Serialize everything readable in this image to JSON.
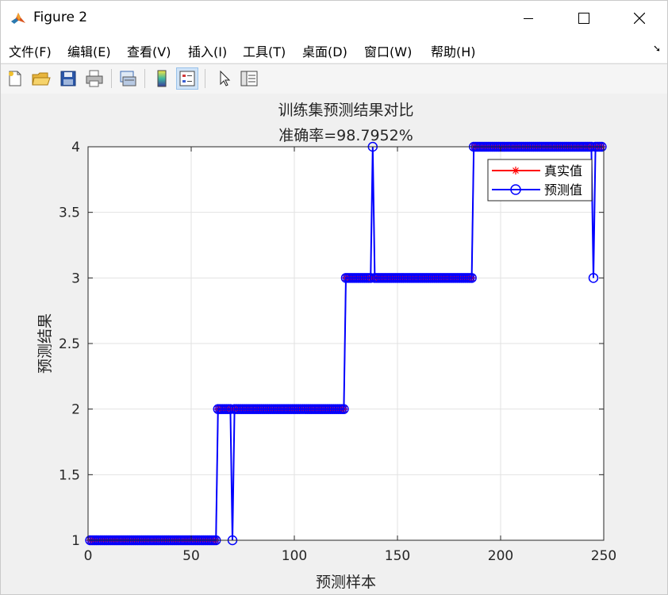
{
  "window": {
    "title": "Figure 2"
  },
  "menubar": {
    "items": [
      "文件(F)",
      "编辑(E)",
      "查看(V)",
      "插入(I)",
      "工具(T)",
      "桌面(D)",
      "窗口(W)",
      "帮助(H)"
    ]
  },
  "toolbar": {
    "icons": [
      "new-figure-icon",
      "open-file-icon",
      "save-icon",
      "print-icon",
      "link-plot-icon",
      "colorbar-icon",
      "legend-icon",
      "edit-plot-icon",
      "property-inspector-icon"
    ]
  },
  "colors": {
    "true_series": "#ff0000",
    "pred_series": "#0000ff",
    "grid": "#e2e2e2",
    "axes": "#262626"
  },
  "chart_data": {
    "type": "line",
    "title": "训练集预测结果对比",
    "subtitle": "准确率=98.7952%",
    "xlabel": "预测样本",
    "ylabel": "预测结果",
    "xlim": [
      0,
      250
    ],
    "ylim": [
      1,
      4
    ],
    "xticks": [
      0,
      50,
      100,
      150,
      200,
      250
    ],
    "yticks": [
      1,
      1.5,
      2,
      2.5,
      3,
      3.5,
      4
    ],
    "grid": true,
    "legend_position": "top-right",
    "series": [
      {
        "name": "真实值",
        "marker": "*",
        "color": "#ff0000",
        "segments": [
          {
            "x_start": 1,
            "x_end": 62,
            "y": 1
          },
          {
            "x_start": 63,
            "x_end": 124,
            "y": 2
          },
          {
            "x_start": 125,
            "x_end": 186,
            "y": 3
          },
          {
            "x_start": 187,
            "x_end": 249,
            "y": 4
          }
        ]
      },
      {
        "name": "预测值",
        "marker": "o",
        "color": "#0000ff",
        "segments": [
          {
            "x_start": 1,
            "x_end": 62,
            "y": 1
          },
          {
            "x_start": 63,
            "x_end": 124,
            "y": 2
          },
          {
            "x_start": 125,
            "x_end": 186,
            "y": 3
          },
          {
            "x_start": 187,
            "x_end": 249,
            "y": 4
          }
        ],
        "overrides": [
          {
            "x": 70,
            "y": 1
          },
          {
            "x": 138,
            "y": 4
          },
          {
            "x": 245,
            "y": 3
          }
        ]
      }
    ]
  }
}
